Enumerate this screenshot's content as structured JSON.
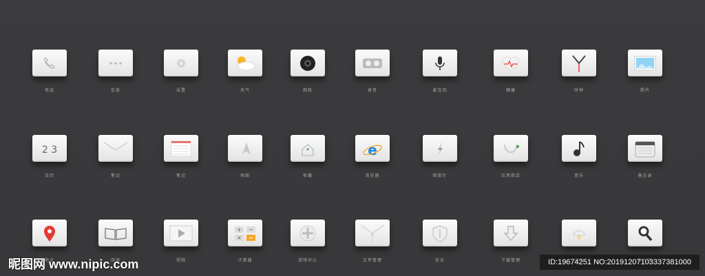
{
  "icons": [
    {
      "label": "电话",
      "icon": "phone-icon"
    },
    {
      "label": "信息",
      "icon": "message-dots-icon"
    },
    {
      "label": "设置",
      "icon": "gear-icon"
    },
    {
      "label": "天气",
      "icon": "weather-icon"
    },
    {
      "label": "相机",
      "icon": "camera-icon"
    },
    {
      "label": "录音",
      "icon": "tape-icon"
    },
    {
      "label": "麦克风",
      "icon": "microphone-icon"
    },
    {
      "label": "健康",
      "icon": "heart-icon"
    },
    {
      "label": "时钟",
      "icon": "clock-icon"
    },
    {
      "label": "照片",
      "icon": "photo-icon"
    },
    {
      "label": "日历",
      "icon": "calendar-number-icon",
      "text": "2 3"
    },
    {
      "label": "笔记",
      "icon": "envelope-icon"
    },
    {
      "label": "笔记",
      "icon": "notepad-icon"
    },
    {
      "label": "地图",
      "icon": "map-icon"
    },
    {
      "label": "收藏",
      "icon": "home-icon"
    },
    {
      "label": "浏览器",
      "icon": "browser-icon"
    },
    {
      "label": "指南针",
      "icon": "compass-icon"
    },
    {
      "label": "应用商店",
      "icon": "app-store-icon"
    },
    {
      "label": "音乐",
      "icon": "music-icon"
    },
    {
      "label": "备忘录",
      "icon": "memo-icon"
    },
    {
      "label": "地点",
      "icon": "location-pin-icon"
    },
    {
      "label": "阅读",
      "icon": "book-icon"
    },
    {
      "label": "视频",
      "icon": "video-icon"
    },
    {
      "label": "计算器",
      "icon": "calculator-icon"
    },
    {
      "label": "游戏中心",
      "icon": "gamepad-icon"
    },
    {
      "label": "文件管理",
      "icon": "folder-icon"
    },
    {
      "label": "安全",
      "icon": "shield-icon"
    },
    {
      "label": "下载管理",
      "icon": "download-icon"
    },
    {
      "label": "灯光",
      "icon": "lamp-icon"
    },
    {
      "label": "放大镜",
      "icon": "magnifier-icon"
    }
  ],
  "watermark": {
    "left": "昵图网 www.nipic.com",
    "right": "ID:19674251 NO:20191207103337381000"
  },
  "colors": {
    "background": "#3a3a3c",
    "accent_red": "#e53935",
    "accent_blue": "#1e88e5",
    "accent_orange": "#f5a623"
  }
}
